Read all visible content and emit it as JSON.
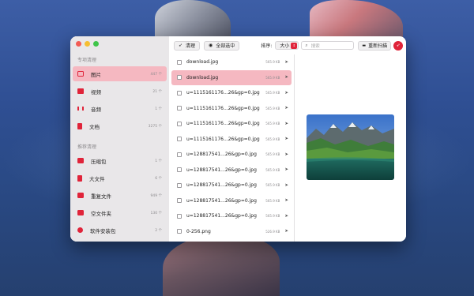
{
  "sidebar": {
    "section1_title": "专项清理",
    "items": [
      {
        "label": "图片",
        "count": "447 个",
        "icon": "image-icon"
      },
      {
        "label": "视频",
        "count": "21 个",
        "icon": "video-icon"
      },
      {
        "label": "音频",
        "count": "1 个",
        "icon": "audio-icon"
      },
      {
        "label": "文档",
        "count": "3275 个",
        "icon": "document-icon"
      }
    ],
    "section2_title": "推荐清理",
    "items2": [
      {
        "label": "压缩包",
        "count": "1 个",
        "icon": "archive-icon"
      },
      {
        "label": "大文件",
        "count": "6 个",
        "icon": "large-file-icon"
      },
      {
        "label": "重复文件",
        "count": "949 个",
        "icon": "duplicate-file-icon"
      },
      {
        "label": "空文件夹",
        "count": "130 个",
        "icon": "empty-folder-icon"
      },
      {
        "label": "软件安装包",
        "count": "2 个",
        "icon": "installer-package-icon"
      }
    ]
  },
  "toolbar": {
    "clean_label": "清理",
    "select_all_label": "全部选中",
    "sort_label": "排序:",
    "sort_value": "大小",
    "search_placeholder": "搜索",
    "rescan_label": "重新扫描"
  },
  "files": [
    {
      "name": "download.jpg",
      "size": "565.9 KB"
    },
    {
      "name": "download.jpg",
      "size": "565.9 KB"
    },
    {
      "name": "u=1115161176...26&gp=0.jpg",
      "size": "565.9 KB"
    },
    {
      "name": "u=1115161176...26&gp=0.jpg",
      "size": "565.9 KB"
    },
    {
      "name": "u=1115161176...26&gp=0.jpg",
      "size": "565.9 KB"
    },
    {
      "name": "u=1115161176...26&gp=0.jpg",
      "size": "565.9 KB"
    },
    {
      "name": "u=128817541...26&gp=0.jpg",
      "size": "565.9 KB"
    },
    {
      "name": "u=128817541...26&gp=0.jpg",
      "size": "565.9 KB"
    },
    {
      "name": "u=128817541...26&gp=0.jpg",
      "size": "565.9 KB"
    },
    {
      "name": "u=128817541...26&gp=0.jpg",
      "size": "565.9 KB"
    },
    {
      "name": "u=128817541...26&gp=0.jpg",
      "size": "565.9 KB"
    },
    {
      "name": "0-256.png",
      "size": "526.9 KB"
    }
  ],
  "colors": {
    "accent": "#e0243a",
    "selection": "#f5b8c1",
    "sidebar_bg": "#e9e7e9"
  }
}
